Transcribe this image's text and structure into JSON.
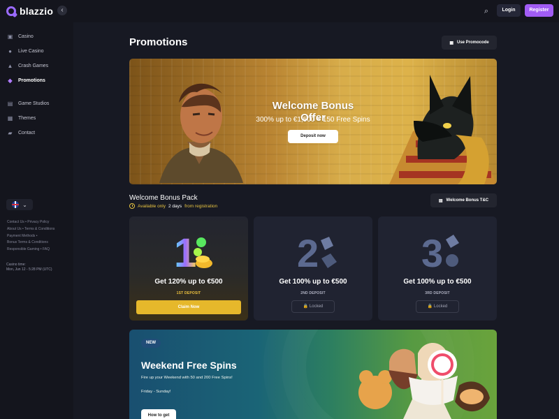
{
  "brand": {
    "name": "blazzio"
  },
  "header": {
    "login": "Login",
    "register": "Register"
  },
  "sidebar": {
    "items": [
      {
        "label": "Casino",
        "icon": "cards-icon"
      },
      {
        "label": "Live Casino",
        "icon": "person-icon"
      },
      {
        "label": "Crash Games",
        "icon": "rocket-icon"
      },
      {
        "label": "Promotions",
        "icon": "megaphone-icon",
        "active": true
      },
      {
        "label": "Game Studios",
        "icon": "studio-icon"
      },
      {
        "label": "Themes",
        "icon": "themes-icon"
      },
      {
        "label": "Contact",
        "icon": "chat-icon"
      }
    ],
    "footer_links": [
      "Contact Us",
      "Privacy Policy",
      "About Us",
      "Terms & Conditions",
      "Payment Methods",
      "Bonus Terms & Conditions",
      "Responsible Gaming",
      "FAQ"
    ],
    "casino_time_label": "Casino time:",
    "casino_time_value": "Mon, Jun 12 - 5:28 PM (UTC)"
  },
  "main": {
    "title": "Promotions",
    "promocode_button": "Use Promocode",
    "hero": {
      "title": "Welcome Bonus Offer",
      "subtitle": "300% up to €1,500 + 150 Free Spins",
      "cta": "Deposit now"
    },
    "bonus_pack": {
      "title": "Welcome Bonus Pack",
      "available_prefix": "Available only",
      "days": "2 days",
      "available_suffix": "from registration",
      "tc_button": "Welcome Bonus T&C",
      "cards": [
        {
          "title": "Get 120% up to €500",
          "label": "1ST DEPOSIT",
          "action": "Claim Now",
          "status": "active",
          "number": "1"
        },
        {
          "title": "Get 100% up to €500",
          "label": "2ND DEPOSIT",
          "action": "Locked",
          "status": "locked",
          "number": "2"
        },
        {
          "title": "Get 100% up to €500",
          "label": "3RD DEPOSIT",
          "action": "Locked",
          "status": "locked",
          "number": "3"
        }
      ]
    },
    "weekend": {
      "badge": "NEW",
      "title": "Weekend Free Spins",
      "subtitle": "Fire up your Weekend with 50 and 200 Free Spins!",
      "days": "Friday - Sunday!",
      "cta": "How to get"
    }
  },
  "colors": {
    "accent": "#a15cf4",
    "gold": "#e6b82b",
    "background": "#14151d"
  }
}
